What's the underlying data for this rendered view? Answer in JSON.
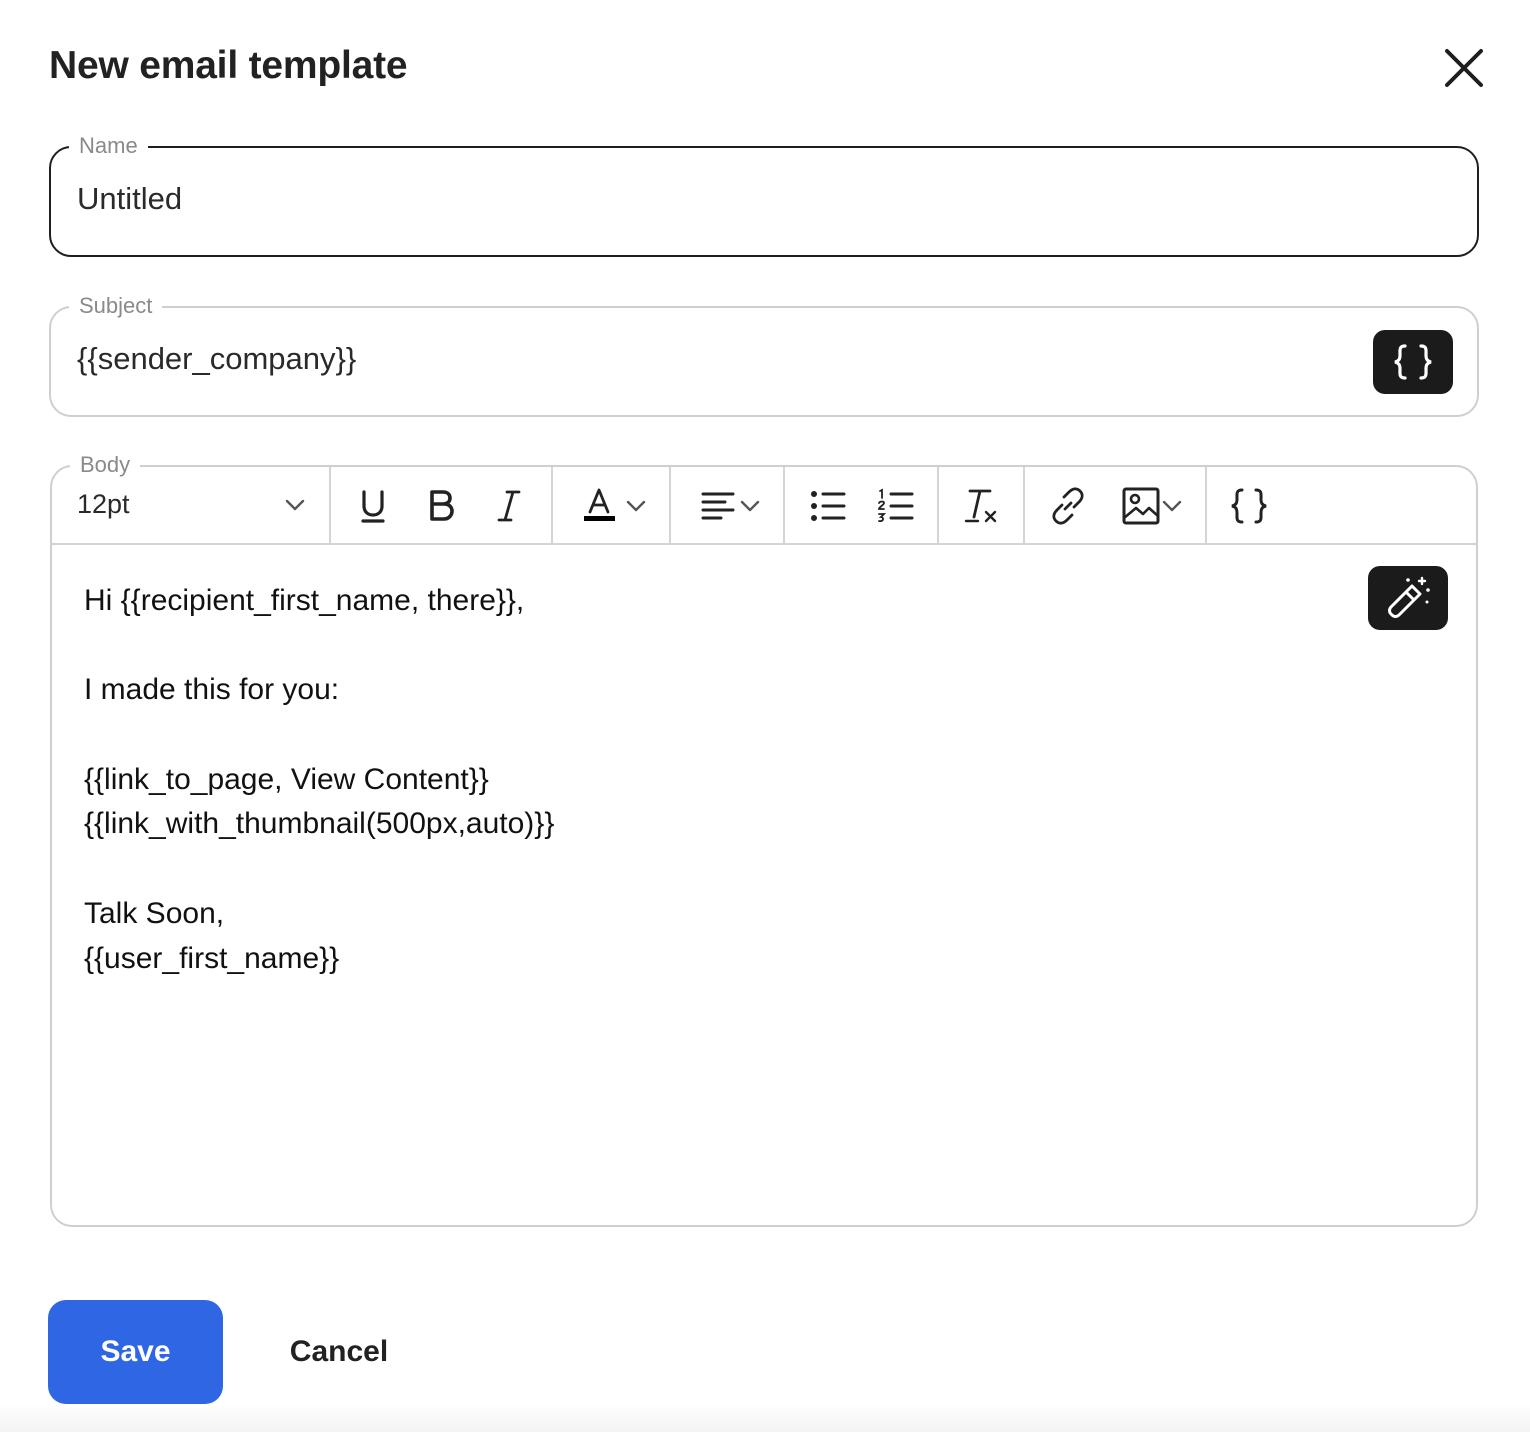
{
  "dialog": {
    "title": "New email template"
  },
  "name_field": {
    "label": "Name",
    "value": "Untitled"
  },
  "subject_field": {
    "label": "Subject",
    "value": "{{sender_company}}",
    "variable_button_icon": "curly-braces-icon"
  },
  "body_field": {
    "label": "Body",
    "toolbar": {
      "font_size": "12pt",
      "buttons": [
        "underline-icon",
        "bold-icon",
        "italic-icon",
        "text-color-icon",
        "align-icon",
        "bullet-list-icon",
        "numbered-list-icon",
        "clear-formatting-icon",
        "link-icon",
        "image-icon",
        "curly-braces-icon"
      ],
      "text_color": "#000000"
    },
    "lines": [
      "Hi {{recipient_first_name, there}},",
      "",
      "I made this for you:",
      "",
      "{{link_to_page, View Content}}",
      "{{link_with_thumbnail(500px,auto)}}",
      "",
      "Talk Soon,",
      "{{user_first_name}}"
    ],
    "magic_button_icon": "magic-wand-icon"
  },
  "actions": {
    "save_label": "Save",
    "cancel_label": "Cancel"
  },
  "colors": {
    "primary": "#2f66e3",
    "dark_button": "#1b1b1b",
    "border": "#cfcfcf"
  }
}
